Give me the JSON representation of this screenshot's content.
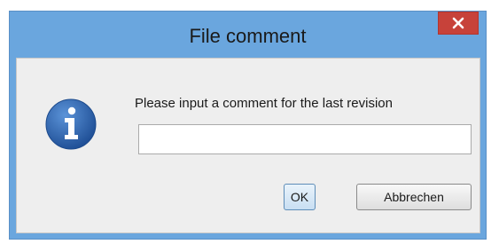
{
  "dialog": {
    "title": "File comment",
    "prompt": "Please input a comment for the last revision",
    "comment_value": "",
    "ok_label": "OK",
    "cancel_label": "Abbrechen"
  },
  "icons": {
    "close": "close-icon",
    "info": "info-icon"
  },
  "colors": {
    "titlebar": "#6aa6de",
    "close_button": "#c7423a",
    "info_icon": "#2f66b3",
    "client_background": "#eeeeee"
  }
}
